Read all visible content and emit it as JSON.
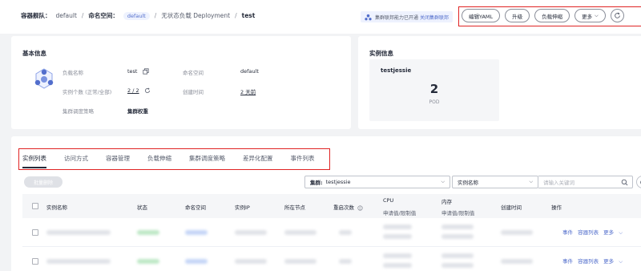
{
  "breadcrumb": {
    "cluster_label": "容器舰队：",
    "cluster_value": "default",
    "sep1": "/",
    "namespace_label": "命名空间：",
    "namespace_value": "default",
    "sep2": "/",
    "workload_type": "无状态负载 Deployment",
    "sep3": "/",
    "current": "test"
  },
  "federation": {
    "text": "集群联邦能力已开通",
    "link": "关闭集群联邦"
  },
  "actions": {
    "edit_yaml": "编辑YAML",
    "upgrade": "升级",
    "scale": "负载伸缩",
    "more": "更多"
  },
  "basic": {
    "title": "基本信息",
    "workload_name_label": "负载名称",
    "workload_name_value": "test",
    "namespace_label": "命名空间",
    "namespace_value": "default",
    "replicas_label": "实例个数 (正常/全部)",
    "replicas_value": "2 / 2",
    "created_label": "创建时间",
    "created_value": "2 天前",
    "policy_label": "集群调度策略",
    "policy_value": "集群权重"
  },
  "instance": {
    "title": "实例信息",
    "cluster_name": "testjessie",
    "pod_count": "2",
    "pod_unit": "POD"
  },
  "tabs": [
    {
      "label": "实例列表",
      "active": true
    },
    {
      "label": "访问方式"
    },
    {
      "label": "容器管理"
    },
    {
      "label": "负载伸缩"
    },
    {
      "label": "集群调度策略"
    },
    {
      "label": "差异化配置"
    },
    {
      "label": "事件列表"
    }
  ],
  "toolbar": {
    "batch_delete": "批量删除",
    "cluster_label": "集群:",
    "cluster_value": "testjessie",
    "field_value": "实例名称",
    "keyword_placeholder": "请输入关键词"
  },
  "table": {
    "headers": {
      "name": "实例名称",
      "status": "状态",
      "namespace": "命名空间",
      "ip": "实例IP",
      "node": "所在节点",
      "restarts": "重启次数",
      "cpu": "CPU",
      "cpu_sub": "申请值/限制值",
      "memory": "内存",
      "memory_sub": "申请值/限制值",
      "created": "创建时间",
      "ops": "操作"
    },
    "row_ops": {
      "events": "事件",
      "containers": "容器列表",
      "more": "更多"
    }
  },
  "colors": {
    "accent": "#526ecc",
    "highlight_box": "#e02424",
    "blur_green": "#bfe8c7",
    "blur_blue": "#c6d6f7",
    "blur_gray": "#e1e3e8"
  }
}
